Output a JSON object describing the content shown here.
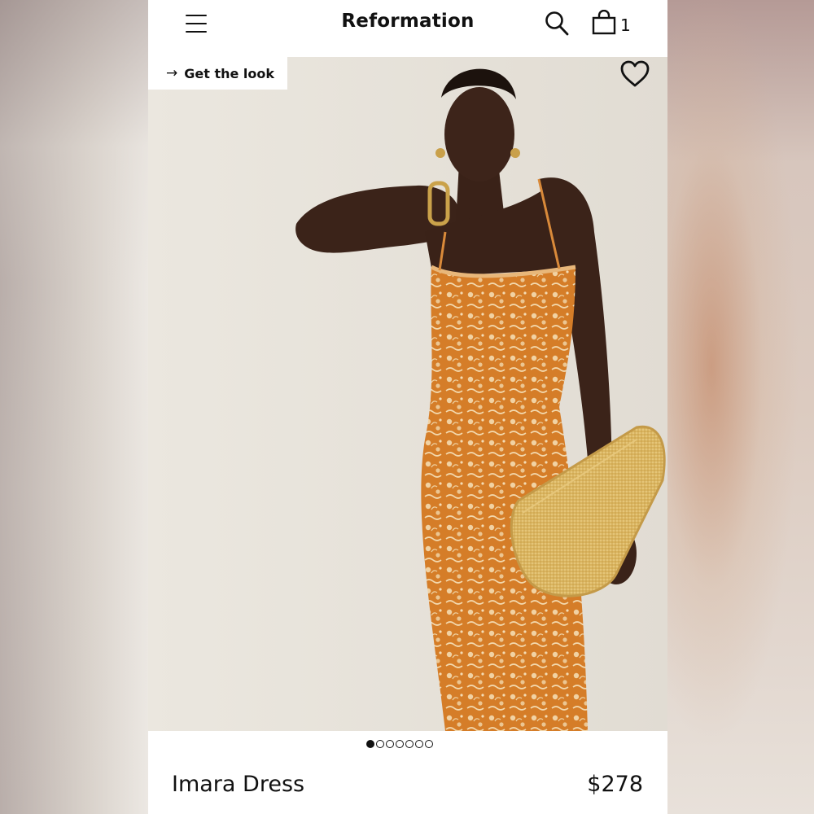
{
  "header": {
    "brand": "Reformation",
    "bag_count": "1"
  },
  "photo": {
    "get_the_look_arrow": "→",
    "get_the_look_label": "Get the look",
    "alt_description_icon": "model-in-orange-floral-dress"
  },
  "carousel": {
    "total": 7,
    "active_index": 0
  },
  "product": {
    "name": "Imara Dress",
    "price": "$278"
  },
  "colors": {
    "dress": "#d9822b",
    "dress_print": "#f0d3a5",
    "clutch": "#d8b05a",
    "skin": "#3a2218",
    "wall": "#e8e4dc"
  }
}
